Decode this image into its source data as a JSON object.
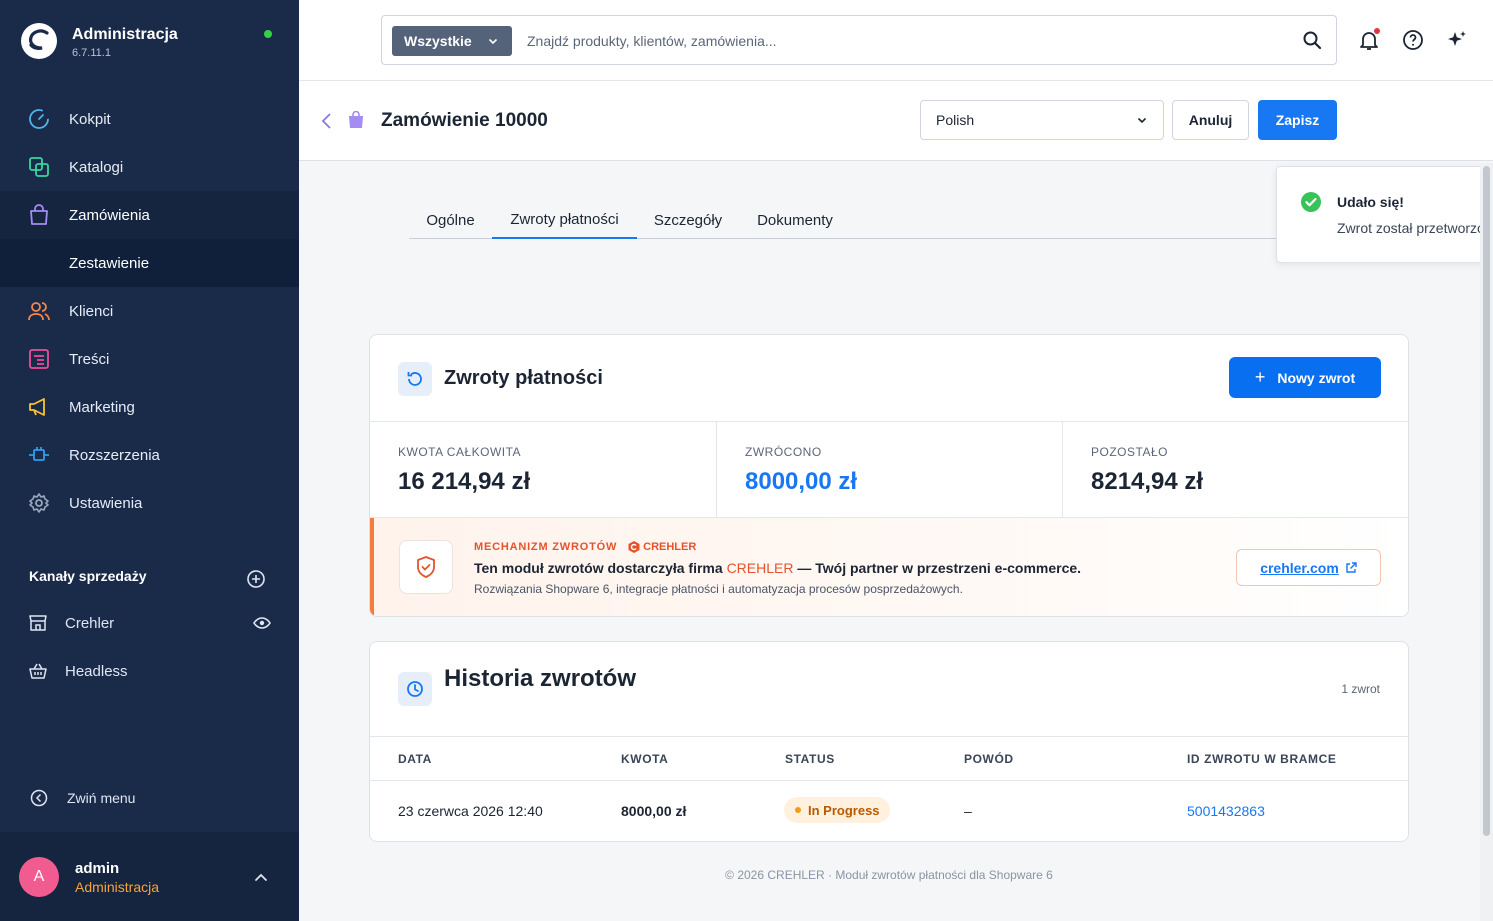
{
  "brand": {
    "title": "Administracja",
    "version": "6.7.11.1"
  },
  "nav": {
    "items": [
      {
        "label": "Kokpit",
        "icon": "dashboard-icon",
        "color": "#4fb4e9"
      },
      {
        "label": "Katalogi",
        "icon": "catalog-icon",
        "color": "#37d6a0"
      },
      {
        "label": "Zamówienia",
        "icon": "orders-bag-icon",
        "color": "#a48cf3"
      },
      {
        "label": "Klienci",
        "icon": "customers-icon",
        "color": "#f6864b"
      },
      {
        "label": "Treści",
        "icon": "content-icon",
        "color": "#ee4d9a"
      },
      {
        "label": "Marketing",
        "icon": "marketing-megaphone-icon",
        "color": "#fbc32b"
      },
      {
        "label": "Rozszerzenia",
        "icon": "extensions-plug-icon",
        "color": "#2e9df0"
      },
      {
        "label": "Ustawienia",
        "icon": "settings-gear-icon",
        "color": "#9aa6b9"
      }
    ],
    "sub_item": "Zestawienie"
  },
  "channels": {
    "heading": "Kanały sprzedaży",
    "items": [
      {
        "label": "Crehler"
      },
      {
        "label": "Headless"
      }
    ]
  },
  "collapse_label": "Zwiń menu",
  "user": {
    "initial": "A",
    "name": "admin",
    "role": "Administracja"
  },
  "search": {
    "filter": "Wszystkie",
    "placeholder": "Znajdź produkty, klientów, zamówienia..."
  },
  "header": {
    "title": "Zamówienie 10000",
    "language": "Polish",
    "cancel": "Anuluj",
    "save": "Zapisz"
  },
  "tabs": [
    "Ogólne",
    "Zwroty płatności",
    "Szczegóły",
    "Dokumenty"
  ],
  "toast": {
    "title": "Udało się!",
    "message": "Zwrot został przetworzo"
  },
  "refunds": {
    "title": "Zwroty płatności",
    "new_button": "Nowy zwrot",
    "stats": [
      {
        "label": "KWOTA CAŁKOWITA",
        "value": "16 214,94 zł"
      },
      {
        "label": "ZWRÓCONO",
        "value": "8000,00 zł"
      },
      {
        "label": "POZOSTAŁO",
        "value": "8214,94 zł"
      }
    ]
  },
  "promo": {
    "kicker": "MECHANIZM ZWROTÓW",
    "brand": "CREHLER",
    "line1_pre": "Ten moduł zwrotów dostarczyła firma ",
    "line1_brand": "CREHLER",
    "line1_post": " — Twój partner w przestrzeni e-commerce.",
    "line2": "Rozwiązania Shopware 6, integracje płatności i automatyzacja procesów posprzedażowych.",
    "link": "crehler.com"
  },
  "history": {
    "title": "Historia zwrotów",
    "count": "1 zwrot",
    "columns": [
      "DATA",
      "KWOTA",
      "STATUS",
      "POWÓD",
      "ID ZWROTU W BRAMCE"
    ],
    "rows": [
      {
        "date": "23 czerwca 2026 12:40",
        "amount": "8000,00 zł",
        "status": "In Progress",
        "reason": "–",
        "gateway_id": "5001432863"
      }
    ]
  },
  "footer": "© 2026 CREHLER · Moduł zwrotów płatności dla Shopware 6"
}
